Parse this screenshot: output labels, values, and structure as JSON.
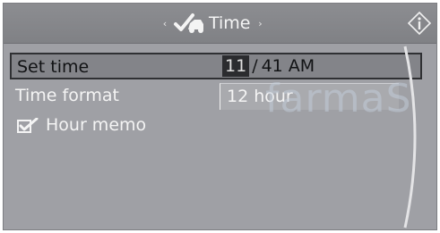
{
  "header": {
    "title": "Time",
    "left_arrow": "‹",
    "right_arrow": "›",
    "icon": "car-checkmark-icon",
    "info_icon": "info-icon"
  },
  "menu": {
    "set_time": {
      "label": "Set time",
      "hours": "11",
      "separator": "/",
      "minutes": "41",
      "ampm": "AM"
    },
    "time_format": {
      "label": "Time format",
      "value": "12 hour"
    },
    "hour_memo": {
      "label": "Hour memo",
      "checked": true
    }
  },
  "watermark": {
    "text": "farmaS"
  },
  "colors": {
    "background": "#9fa0a5",
    "titlebar": "#808185",
    "selected_row": "#838489",
    "highlight": "#2b2c2f",
    "text_light": "#f4f4f4",
    "text_dark": "#111214"
  }
}
